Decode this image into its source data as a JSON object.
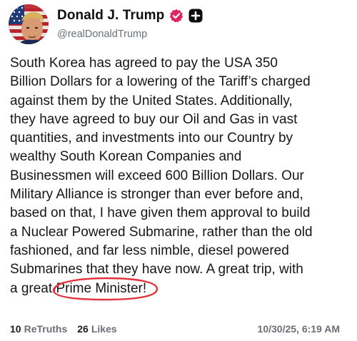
{
  "author": {
    "display_name": "Donald J. Trump",
    "handle": "@realDonaldTrump",
    "verified_badge_icon": "verified-check-icon",
    "plus_icon": "plus-badge-icon",
    "verified_color": "#e0245e"
  },
  "post": {
    "lines": [
      "South Korea has agreed to pay the USA 350",
      "Billion Dollars for a lowering of the Tariff’s charged",
      "against them by the United States. Additionally,",
      "they have agreed to buy our Oil and Gas in vast",
      "quantities, and investments into our Country by",
      "wealthy South Korean Companies and",
      "Businessmen will exceed 600 Billion Dollars. Our",
      "Military Alliance is stronger than ever before and,",
      "based on that, I have given them approval to build",
      "a Nuclear Powered Submarine, rather than the old",
      "fashioned, and far less nimble, diesel powered",
      "Submarines that they have now. A great trip, with"
    ],
    "last_line_prefix": "a great ",
    "last_line_circled": "Prime Minister!",
    "annotation_color": "#e0323c"
  },
  "stats": {
    "retruths_count": "10",
    "retruths_label": "ReTruths",
    "likes_count": "26",
    "likes_label": "Likes",
    "timestamp": "10/30/25, 6:19 AM"
  }
}
